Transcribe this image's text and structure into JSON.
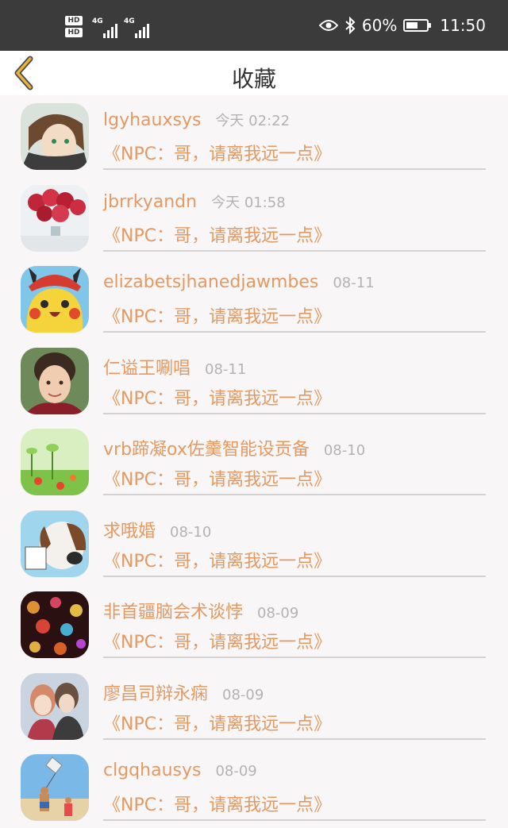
{
  "status_bar": {
    "hd1": "HD",
    "hd2": "HD",
    "net1": "4G",
    "net2": "4G",
    "battery_percent": "60%",
    "battery_level": 0.6,
    "time": "11:50",
    "icons": [
      "eye-icon",
      "bluetooth-icon",
      "battery-icon"
    ]
  },
  "header": {
    "title": "收藏",
    "back_icon": "chevron-left-icon",
    "accent_color": "#e8b33a"
  },
  "favorites": [
    {
      "username": "lgyhauxsys",
      "time": "今天 02:22",
      "title": "《NPC：哥，请离我远一点》"
    },
    {
      "username": "jbrrkyandn",
      "time": "今天 01:58",
      "title": "《NPC：哥，请离我远一点》"
    },
    {
      "username": "elizabetsjhanedjawmbes",
      "time": "08-11",
      "title": "《NPC：哥，请离我远一点》"
    },
    {
      "username": "仁谥王唰唱",
      "time": "08-11",
      "title": "《NPC：哥，请离我远一点》"
    },
    {
      "username": "vrb蹄凝ox佐羹智能设贡备",
      "time": "08-10",
      "title": "《NPC：哥，请离我远一点》"
    },
    {
      "username": "求哦婚",
      "time": "08-10",
      "title": "《NPC：哥，请离我远一点》"
    },
    {
      "username": "非首疆脑会术谈悖",
      "time": "08-09",
      "title": "《NPC：哥，请离我远一点》"
    },
    {
      "username": "廖昌司辩永痫",
      "time": "08-09",
      "title": "《NPC：哥，请离我远一点》"
    },
    {
      "username": "clgqhausys",
      "time": "08-09",
      "title": "《NPC：哥，请离我远一点》"
    }
  ],
  "colors": {
    "status_bar_bg": "#3b3b3b",
    "text_accent": "#e59962",
    "time_text": "#b3b3b3",
    "page_bg": "#f8f6f6"
  }
}
